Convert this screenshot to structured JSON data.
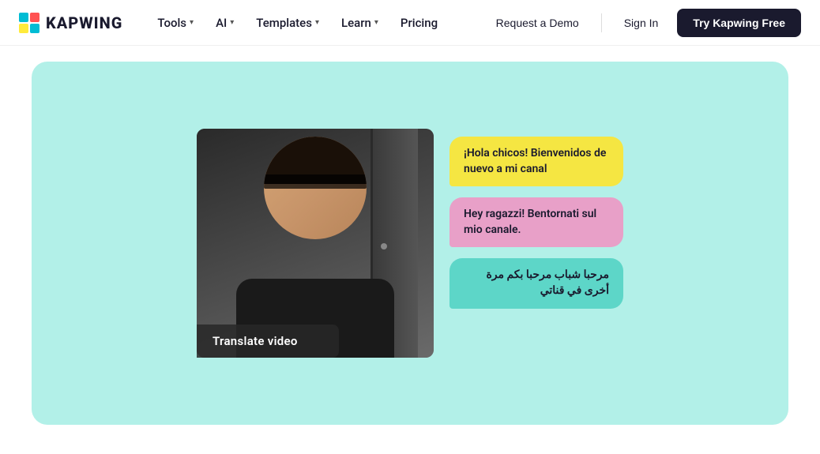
{
  "navbar": {
    "logo_text": "KAPWING",
    "nav_items": [
      {
        "label": "Tools",
        "has_dropdown": true
      },
      {
        "label": "AI",
        "has_dropdown": true
      },
      {
        "label": "Templates",
        "has_dropdown": true
      },
      {
        "label": "Learn",
        "has_dropdown": true
      },
      {
        "label": "Pricing",
        "has_dropdown": false
      }
    ],
    "request_demo_label": "Request a Demo",
    "sign_in_label": "Sign In",
    "try_free_label": "Try Kapwing Free"
  },
  "hero": {
    "translate_label": "Translate video",
    "bubble1_text": "¡Hola chicos! Bienvenidos de nuevo a mi canal",
    "bubble2_text": "Hey ragazzi! Bentornati sul mio canale.",
    "bubble3_text": "مرحبا شباب مرحبا بكم مرة أخرى في قناتي"
  },
  "icons": {
    "chevron_down": "▾"
  }
}
